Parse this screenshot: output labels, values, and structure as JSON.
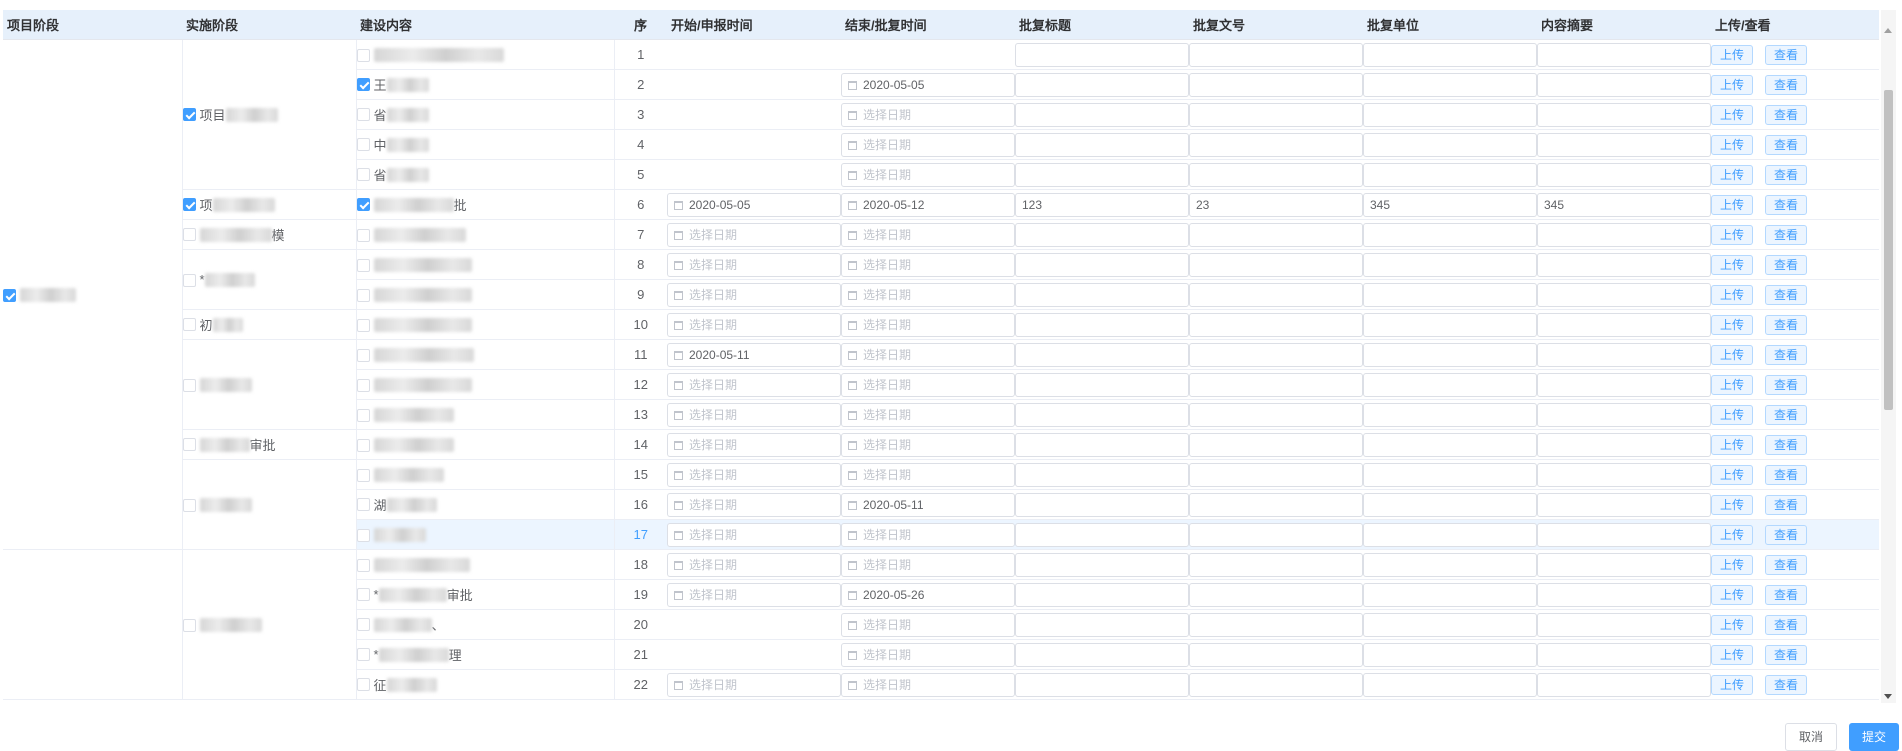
{
  "columns": {
    "project_stage": "项目阶段",
    "impl_stage": "实施阶段",
    "content": "建设内容",
    "seq": "序",
    "start": "开始/申报时间",
    "end": "结束/批复时间",
    "approval_title": "批复标题",
    "approval_no": "批复文号",
    "approval_unit": "批复单位",
    "summary": "内容摘要",
    "upload_view": "上传/查看"
  },
  "placeholder_date": "选择日期",
  "buttons": {
    "upload": "上传",
    "view": "查看",
    "cancel": "取消",
    "submit": "提交"
  },
  "project_groups": [
    {
      "checked": true,
      "label": ""
    },
    {
      "checked": false,
      "label": ""
    }
  ],
  "impl_groups": [
    {
      "checked": true,
      "label": "项目",
      "label_tail": ""
    },
    {
      "checked": true,
      "label": "项",
      "label_tail": ""
    },
    {
      "checked": false,
      "label": "",
      "label_tail": "模"
    },
    {
      "checked": false,
      "label": "*",
      "label_tail": ""
    },
    {
      "checked": false,
      "label": "初",
      "label_tail": ""
    },
    {
      "checked": false,
      "label": "",
      "label_tail": ""
    },
    {
      "checked": false,
      "label": "",
      "label_tail": "审批"
    },
    {
      "checked": false,
      "label": "",
      "label_tail": ""
    },
    {
      "checked": false,
      "label": "",
      "label_tail": ""
    }
  ],
  "rows": [
    {
      "seq": "1",
      "checked": false,
      "label": "",
      "tail": "",
      "start": null,
      "end": null,
      "title": "",
      "no": "",
      "unit": "",
      "summary": ""
    },
    {
      "seq": "2",
      "checked": true,
      "label": "王",
      "tail": "",
      "start": null,
      "end": "2020-05-05",
      "title": "",
      "no": "",
      "unit": "",
      "summary": ""
    },
    {
      "seq": "3",
      "checked": false,
      "label": "省",
      "tail": "",
      "start": null,
      "end": "",
      "title": "",
      "no": "",
      "unit": "",
      "summary": ""
    },
    {
      "seq": "4",
      "checked": false,
      "label": "中",
      "tail": "",
      "start": null,
      "end": "",
      "title": "",
      "no": "",
      "unit": "",
      "summary": ""
    },
    {
      "seq": "5",
      "checked": false,
      "label": "省",
      "tail": "",
      "start": null,
      "end": "",
      "title": "",
      "no": "",
      "unit": "",
      "summary": ""
    },
    {
      "seq": "6",
      "checked": true,
      "label": "",
      "tail": "批",
      "start": "2020-05-05",
      "end": "2020-05-12",
      "title": "123",
      "no": "23",
      "unit": "345",
      "summary": "345"
    },
    {
      "seq": "7",
      "checked": false,
      "label": "",
      "tail": "",
      "start": "",
      "end": "",
      "title": "",
      "no": "",
      "unit": "",
      "summary": ""
    },
    {
      "seq": "8",
      "checked": false,
      "label": "",
      "tail": "",
      "start": "",
      "end": "",
      "title": "",
      "no": "",
      "unit": "",
      "summary": ""
    },
    {
      "seq": "9",
      "checked": false,
      "label": "",
      "tail": "",
      "start": "",
      "end": "",
      "title": "",
      "no": "",
      "unit": "",
      "summary": ""
    },
    {
      "seq": "10",
      "checked": false,
      "label": "",
      "tail": "",
      "start": "",
      "end": "",
      "title": "",
      "no": "",
      "unit": "",
      "summary": ""
    },
    {
      "seq": "11",
      "checked": false,
      "label": "",
      "tail": "",
      "start": "2020-05-11",
      "end": "",
      "title": "",
      "no": "",
      "unit": "",
      "summary": ""
    },
    {
      "seq": "12",
      "checked": false,
      "label": "",
      "tail": "",
      "start": "",
      "end": "",
      "title": "",
      "no": "",
      "unit": "",
      "summary": ""
    },
    {
      "seq": "13",
      "checked": false,
      "label": "",
      "tail": "",
      "start": "",
      "end": "",
      "title": "",
      "no": "",
      "unit": "",
      "summary": ""
    },
    {
      "seq": "14",
      "checked": false,
      "label": "",
      "tail": "",
      "start": "",
      "end": "",
      "title": "",
      "no": "",
      "unit": "",
      "summary": ""
    },
    {
      "seq": "15",
      "checked": false,
      "label": "",
      "tail": "",
      "start": "",
      "end": "",
      "title": "",
      "no": "",
      "unit": "",
      "summary": ""
    },
    {
      "seq": "16",
      "checked": false,
      "label": "湖",
      "tail": "",
      "start": "",
      "end": "2020-05-11",
      "title": "",
      "no": "",
      "unit": "",
      "summary": ""
    },
    {
      "seq": "17",
      "checked": false,
      "label": "",
      "tail": "",
      "start": "",
      "end": "",
      "title": "",
      "no": "",
      "unit": "",
      "summary": "",
      "highlight": true
    },
    {
      "seq": "18",
      "checked": false,
      "label": "",
      "tail": "",
      "start": "",
      "end": "",
      "title": "",
      "no": "",
      "unit": "",
      "summary": ""
    },
    {
      "seq": "19",
      "checked": false,
      "label": "*",
      "tail": "审批",
      "start": "",
      "end": "2020-05-26",
      "title": "",
      "no": "",
      "unit": "",
      "summary": ""
    },
    {
      "seq": "20",
      "checked": false,
      "label": "",
      "tail": "、",
      "start": null,
      "end": "",
      "title": "",
      "no": "",
      "unit": "",
      "summary": ""
    },
    {
      "seq": "21",
      "checked": false,
      "label": "*",
      "tail": "理",
      "start": null,
      "end": "",
      "title": "",
      "no": "",
      "unit": "",
      "summary": ""
    },
    {
      "seq": "22",
      "checked": false,
      "label": "征",
      "tail": "",
      "start": "",
      "end": "",
      "title": "",
      "no": "",
      "unit": "",
      "summary": ""
    }
  ]
}
